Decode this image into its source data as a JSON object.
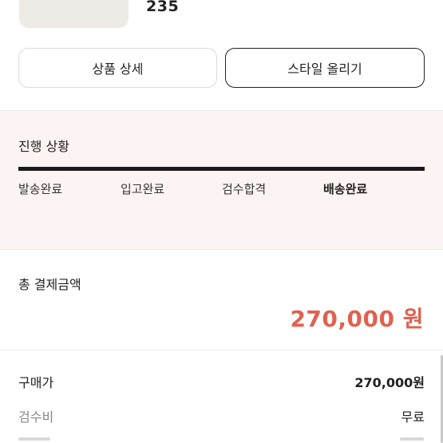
{
  "product": {
    "size": "235"
  },
  "actions": {
    "detail_label": "상품 상세",
    "style_label": "스타일 올리기"
  },
  "progress": {
    "title": "진행 상황",
    "steps": [
      "발송완료",
      "입고완료",
      "검수합격",
      "배송완료"
    ],
    "current_step": "배송완료",
    "completion": 1.0
  },
  "payment": {
    "total_label": "총 결제금액",
    "total_amount": "270,000 원",
    "price_label": "구매가",
    "price_value": "270,000원",
    "fee_label": "검수비",
    "fee_value": "무료"
  },
  "colors": {
    "accent": "#e0614f",
    "progress_bg": "#fbf4f3"
  }
}
